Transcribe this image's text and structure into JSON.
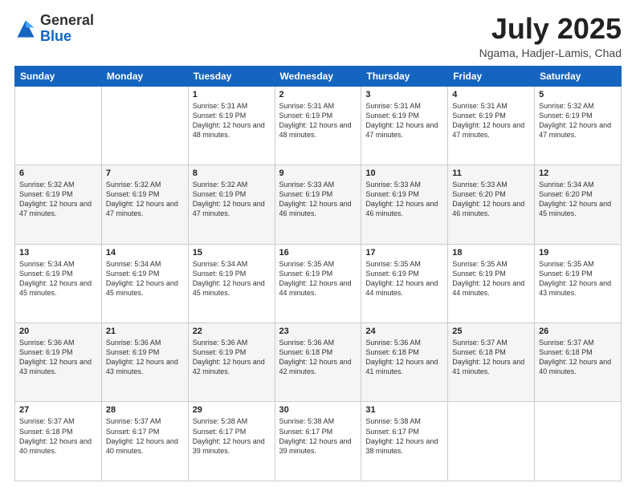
{
  "header": {
    "logo": {
      "general": "General",
      "blue": "Blue"
    },
    "title": "July 2025",
    "location": "Ngama, Hadjer-Lamis, Chad"
  },
  "weekdays": [
    "Sunday",
    "Monday",
    "Tuesday",
    "Wednesday",
    "Thursday",
    "Friday",
    "Saturday"
  ],
  "weeks": [
    [
      {
        "day": "",
        "sunrise": "",
        "sunset": "",
        "daylight": ""
      },
      {
        "day": "",
        "sunrise": "",
        "sunset": "",
        "daylight": ""
      },
      {
        "day": "1",
        "sunrise": "Sunrise: 5:31 AM",
        "sunset": "Sunset: 6:19 PM",
        "daylight": "Daylight: 12 hours and 48 minutes."
      },
      {
        "day": "2",
        "sunrise": "Sunrise: 5:31 AM",
        "sunset": "Sunset: 6:19 PM",
        "daylight": "Daylight: 12 hours and 48 minutes."
      },
      {
        "day": "3",
        "sunrise": "Sunrise: 5:31 AM",
        "sunset": "Sunset: 6:19 PM",
        "daylight": "Daylight: 12 hours and 47 minutes."
      },
      {
        "day": "4",
        "sunrise": "Sunrise: 5:31 AM",
        "sunset": "Sunset: 6:19 PM",
        "daylight": "Daylight: 12 hours and 47 minutes."
      },
      {
        "day": "5",
        "sunrise": "Sunrise: 5:32 AM",
        "sunset": "Sunset: 6:19 PM",
        "daylight": "Daylight: 12 hours and 47 minutes."
      }
    ],
    [
      {
        "day": "6",
        "sunrise": "Sunrise: 5:32 AM",
        "sunset": "Sunset: 6:19 PM",
        "daylight": "Daylight: 12 hours and 47 minutes."
      },
      {
        "day": "7",
        "sunrise": "Sunrise: 5:32 AM",
        "sunset": "Sunset: 6:19 PM",
        "daylight": "Daylight: 12 hours and 47 minutes."
      },
      {
        "day": "8",
        "sunrise": "Sunrise: 5:32 AM",
        "sunset": "Sunset: 6:19 PM",
        "daylight": "Daylight: 12 hours and 47 minutes."
      },
      {
        "day": "9",
        "sunrise": "Sunrise: 5:33 AM",
        "sunset": "Sunset: 6:19 PM",
        "daylight": "Daylight: 12 hours and 46 minutes."
      },
      {
        "day": "10",
        "sunrise": "Sunrise: 5:33 AM",
        "sunset": "Sunset: 6:19 PM",
        "daylight": "Daylight: 12 hours and 46 minutes."
      },
      {
        "day": "11",
        "sunrise": "Sunrise: 5:33 AM",
        "sunset": "Sunset: 6:20 PM",
        "daylight": "Daylight: 12 hours and 46 minutes."
      },
      {
        "day": "12",
        "sunrise": "Sunrise: 5:34 AM",
        "sunset": "Sunset: 6:20 PM",
        "daylight": "Daylight: 12 hours and 45 minutes."
      }
    ],
    [
      {
        "day": "13",
        "sunrise": "Sunrise: 5:34 AM",
        "sunset": "Sunset: 6:19 PM",
        "daylight": "Daylight: 12 hours and 45 minutes."
      },
      {
        "day": "14",
        "sunrise": "Sunrise: 5:34 AM",
        "sunset": "Sunset: 6:19 PM",
        "daylight": "Daylight: 12 hours and 45 minutes."
      },
      {
        "day": "15",
        "sunrise": "Sunrise: 5:34 AM",
        "sunset": "Sunset: 6:19 PM",
        "daylight": "Daylight: 12 hours and 45 minutes."
      },
      {
        "day": "16",
        "sunrise": "Sunrise: 5:35 AM",
        "sunset": "Sunset: 6:19 PM",
        "daylight": "Daylight: 12 hours and 44 minutes."
      },
      {
        "day": "17",
        "sunrise": "Sunrise: 5:35 AM",
        "sunset": "Sunset: 6:19 PM",
        "daylight": "Daylight: 12 hours and 44 minutes."
      },
      {
        "day": "18",
        "sunrise": "Sunrise: 5:35 AM",
        "sunset": "Sunset: 6:19 PM",
        "daylight": "Daylight: 12 hours and 44 minutes."
      },
      {
        "day": "19",
        "sunrise": "Sunrise: 5:35 AM",
        "sunset": "Sunset: 6:19 PM",
        "daylight": "Daylight: 12 hours and 43 minutes."
      }
    ],
    [
      {
        "day": "20",
        "sunrise": "Sunrise: 5:36 AM",
        "sunset": "Sunset: 6:19 PM",
        "daylight": "Daylight: 12 hours and 43 minutes."
      },
      {
        "day": "21",
        "sunrise": "Sunrise: 5:36 AM",
        "sunset": "Sunset: 6:19 PM",
        "daylight": "Daylight: 12 hours and 43 minutes."
      },
      {
        "day": "22",
        "sunrise": "Sunrise: 5:36 AM",
        "sunset": "Sunset: 6:19 PM",
        "daylight": "Daylight: 12 hours and 42 minutes."
      },
      {
        "day": "23",
        "sunrise": "Sunrise: 5:36 AM",
        "sunset": "Sunset: 6:18 PM",
        "daylight": "Daylight: 12 hours and 42 minutes."
      },
      {
        "day": "24",
        "sunrise": "Sunrise: 5:36 AM",
        "sunset": "Sunset: 6:18 PM",
        "daylight": "Daylight: 12 hours and 41 minutes."
      },
      {
        "day": "25",
        "sunrise": "Sunrise: 5:37 AM",
        "sunset": "Sunset: 6:18 PM",
        "daylight": "Daylight: 12 hours and 41 minutes."
      },
      {
        "day": "26",
        "sunrise": "Sunrise: 5:37 AM",
        "sunset": "Sunset: 6:18 PM",
        "daylight": "Daylight: 12 hours and 40 minutes."
      }
    ],
    [
      {
        "day": "27",
        "sunrise": "Sunrise: 5:37 AM",
        "sunset": "Sunset: 6:18 PM",
        "daylight": "Daylight: 12 hours and 40 minutes."
      },
      {
        "day": "28",
        "sunrise": "Sunrise: 5:37 AM",
        "sunset": "Sunset: 6:17 PM",
        "daylight": "Daylight: 12 hours and 40 minutes."
      },
      {
        "day": "29",
        "sunrise": "Sunrise: 5:38 AM",
        "sunset": "Sunset: 6:17 PM",
        "daylight": "Daylight: 12 hours and 39 minutes."
      },
      {
        "day": "30",
        "sunrise": "Sunrise: 5:38 AM",
        "sunset": "Sunset: 6:17 PM",
        "daylight": "Daylight: 12 hours and 39 minutes."
      },
      {
        "day": "31",
        "sunrise": "Sunrise: 5:38 AM",
        "sunset": "Sunset: 6:17 PM",
        "daylight": "Daylight: 12 hours and 38 minutes."
      },
      {
        "day": "",
        "sunrise": "",
        "sunset": "",
        "daylight": ""
      },
      {
        "day": "",
        "sunrise": "",
        "sunset": "",
        "daylight": ""
      }
    ]
  ]
}
